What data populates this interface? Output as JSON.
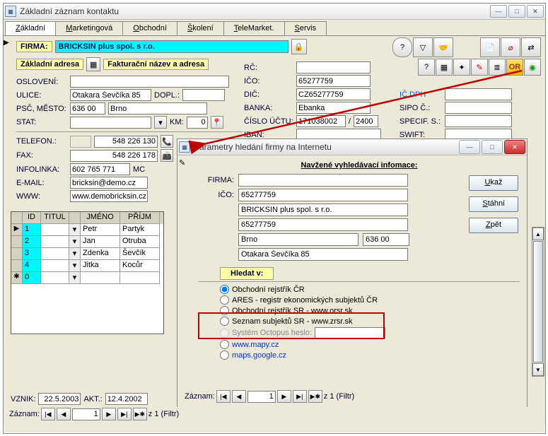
{
  "mainWindow": {
    "title": "Základní záznam kontaktu",
    "tabs": [
      "Základní",
      "Marketingová",
      "Obchodní",
      "Školení",
      "TeleMarket.",
      "Servis"
    ],
    "labels": {
      "firma": "FIRMA:",
      "adresa": "Základní adresa",
      "faktAdresa": "Fakturační název a adresa",
      "osloveni": "OSLOVENÍ:",
      "ulice": "ULICE:",
      "dopl": "DOPL.:",
      "pscmesto": "PSČ, MĚSTO:",
      "stat": "STAT:",
      "km": "KM:",
      "telefon": "TELEFON.:",
      "fax": "FAX:",
      "infolinka": "INFOLINKA:",
      "email": "E-MAIL:",
      "www": "WWW:",
      "rc": "RČ:",
      "ico": "IČO:",
      "dic": "DIČ:",
      "banka": "BANKA:",
      "ucet": "ČÍSLO ÚČTU:",
      "iban": "IBAN:",
      "icdph": "IČ DPH",
      "sipoc": "SIPO Č.:",
      "specs": "SPECIF. S.:",
      "swift": "SWIFT:",
      "vznik": "VZNIK:",
      "akt": "AKT.:",
      "zaznam": "Záznam:",
      "filtr": "z  1 (Filtr)"
    },
    "values": {
      "firma": "BRICKSIN plus spol. s r.o.",
      "ulice": "Otakara Ševčíka 85",
      "psc": "636 00",
      "mesto": "Brno",
      "km": "0",
      "tel": "548 226 130",
      "fax": "548 226 178",
      "info": "602 765 771",
      "email": "bricksin@demo.cz",
      "www": "www.demobricksin.cz",
      "ico": "65277759",
      "dic": "CZ65277759",
      "banka": "Ebanka",
      "ucet": "171038002",
      "ucet2": "2400",
      "vznik": "22.5.2003",
      "akt": "12.4.2002",
      "recno": "1",
      "mc": "MC"
    },
    "grid": {
      "headers": [
        "",
        "ID",
        "TITUL",
        "",
        "JMÉNO",
        "PŘÍJM"
      ],
      "rows": [
        {
          "mark": "▶",
          "id": "1",
          "titul": "",
          "jmeno": "Petr",
          "prijm": "Partyk"
        },
        {
          "mark": "",
          "id": "2",
          "titul": "",
          "jmeno": "Jan",
          "prijm": "Otruba"
        },
        {
          "mark": "",
          "id": "3",
          "titul": "",
          "jmeno": "Zdenka",
          "prijm": "Ševčík"
        },
        {
          "mark": "",
          "id": "4",
          "titul": "",
          "jmeno": "Jitka",
          "prijm": "Kocůr"
        },
        {
          "mark": "✱",
          "id": "0",
          "titul": "",
          "jmeno": "",
          "prijm": ""
        }
      ]
    }
  },
  "dialog": {
    "title": "Parametry hledání firmy na Internetu",
    "heading": "Navžené vyhledávací infomace:",
    "labels": {
      "firma": "FIRMA:",
      "ico": "IČO:",
      "hledatv": "Hledat v:",
      "zaznam": "Záznam:",
      "filtr": "z  1 (Filtr)"
    },
    "values": {
      "firma": "",
      "ico": "65277759",
      "firma2": "BRICKSIN plus spol. s r.o.",
      "ico2": "65277759",
      "mesto": "Brno",
      "psc": "636 00",
      "ulice": "Otakara Ševčíka 85",
      "recno": "1"
    },
    "buttons": {
      "ukaz": "Ukaž",
      "stahni": "Stáhni",
      "zpet": "Zpět"
    },
    "radios": [
      "Obchodní rejstřík ČR",
      "ARES - registr ekonomických subjektů ČR",
      "Obchodní rejstřík SR - www.orsr.sk",
      "Seznam subjektů SR - www.zrsr.sk",
      "Systém Octopus  heslo:"
    ],
    "links": [
      "www.mapy.cz",
      "maps.google.cz"
    ]
  },
  "icons": {
    "lock": "🔒",
    "help": "?",
    "funnel": "▽",
    "or": "OR"
  }
}
